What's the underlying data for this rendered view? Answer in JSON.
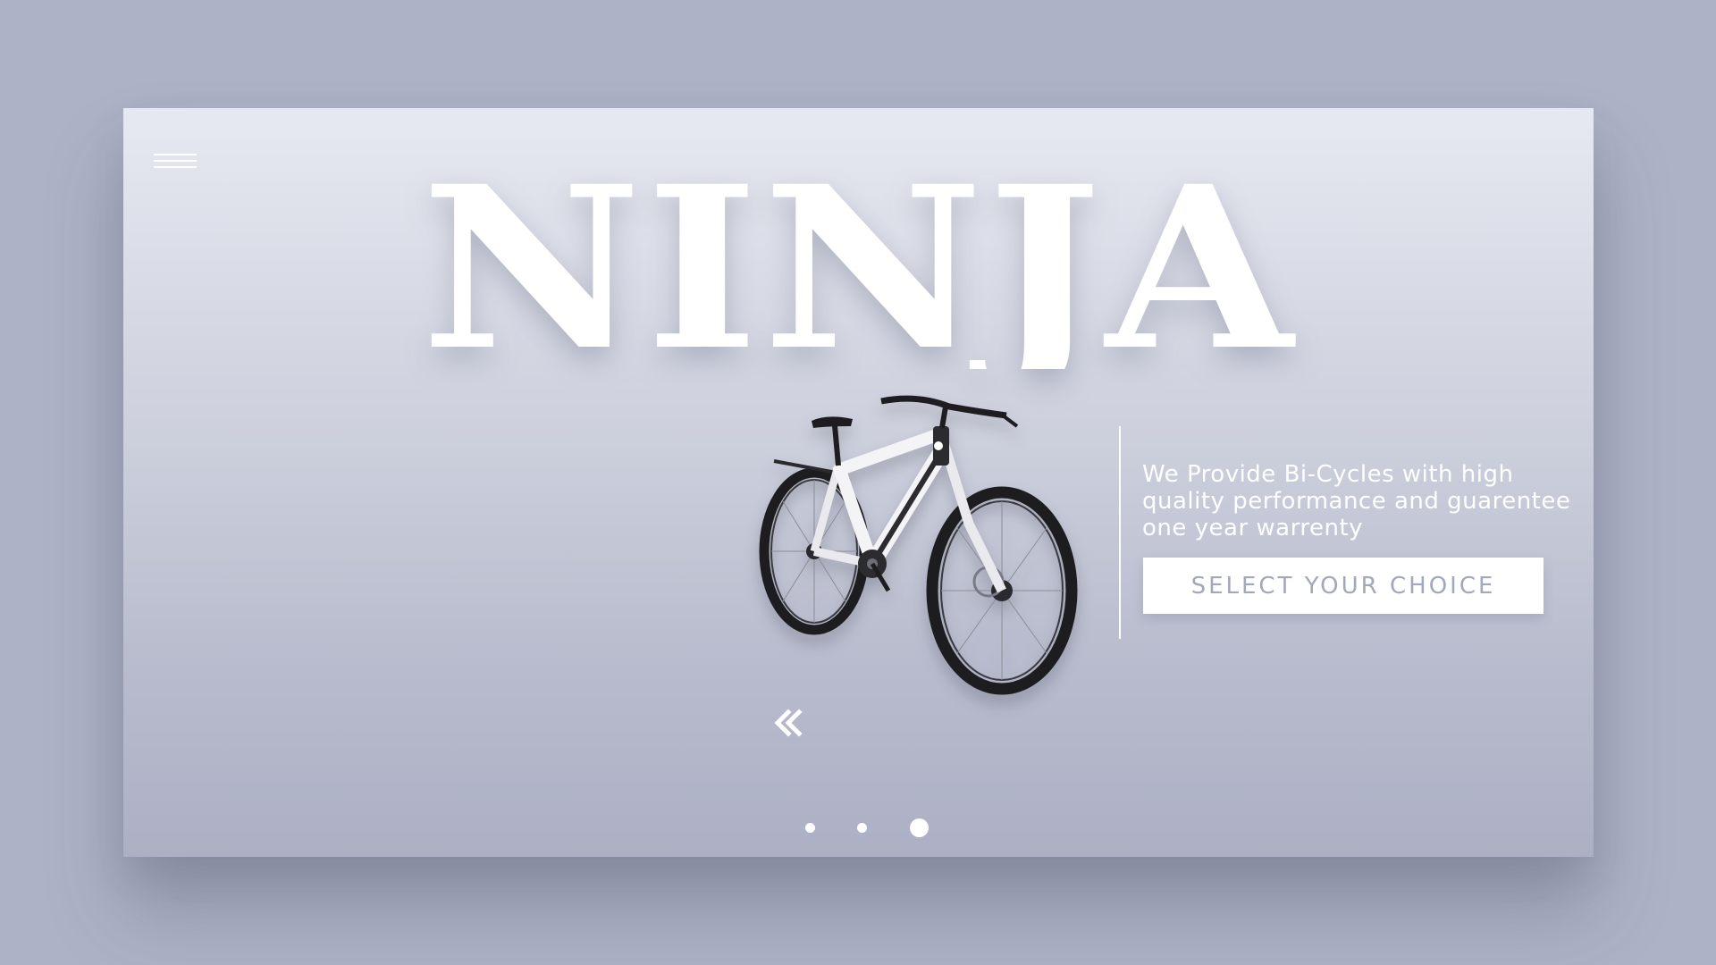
{
  "hero": {
    "title": "NINJA",
    "tagline": "We Provide Bi-Cycles with high quality performance and guarentee one year warrenty",
    "cta_label": "SELECT YOUR CHOICE"
  },
  "icons": {
    "menu": "hamburger-menu-icon",
    "prev": "double-chevron-left-icon"
  },
  "carousel": {
    "slide_count": 3,
    "active_index": 2
  },
  "colors": {
    "page_background": "#aeb2c6",
    "card_top": "#e6e9f1",
    "card_bottom": "#adb0c4",
    "accent_text": "#ffffff",
    "button_text": "#a3a7bb"
  }
}
